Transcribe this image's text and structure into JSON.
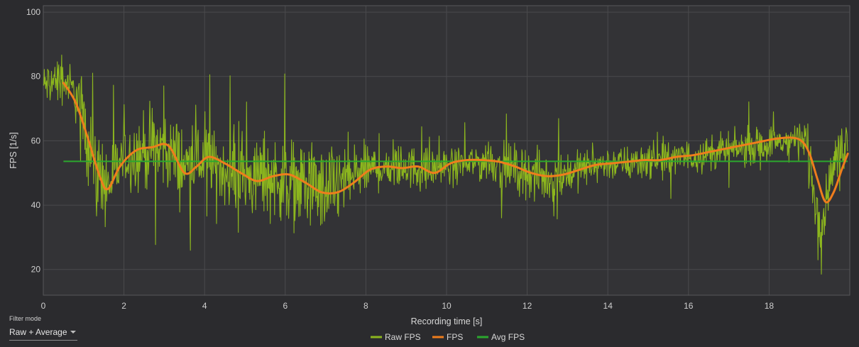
{
  "chart_data": {
    "type": "line",
    "xlabel": "Recording time [s]",
    "ylabel": "FPS [1/s]",
    "xlim": [
      0,
      20
    ],
    "ylim": [
      12,
      102
    ],
    "xticks": [
      0,
      2,
      4,
      6,
      8,
      10,
      12,
      14,
      16,
      18
    ],
    "yticks": [
      20,
      40,
      60,
      80,
      100
    ],
    "grid": true,
    "legend_position": "bottom-center",
    "series": [
      {
        "name": "Raw FPS",
        "color": "#8cb61e",
        "style": "noisy-line",
        "envelope_x": [
          0,
          0.3,
          0.6,
          0.9,
          1.1,
          1.3,
          1.6,
          2.0,
          2.5,
          3.0,
          3.5,
          4.0,
          4.5,
          5.0,
          5.5,
          6.0,
          6.5,
          7.0,
          7.5,
          8.0,
          8.5,
          9.0,
          9.5,
          10.0,
          10.5,
          11.0,
          11.5,
          12.0,
          12.5,
          13.0,
          13.5,
          14.0,
          14.5,
          15.0,
          15.5,
          16.0,
          16.5,
          17.0,
          17.5,
          18.0,
          18.5,
          18.9,
          19.1,
          19.3,
          19.5,
          19.7,
          19.95
        ],
        "envelope_center": [
          77,
          79,
          78,
          72,
          62,
          50,
          46,
          55,
          57,
          58,
          52,
          54,
          51,
          48,
          49,
          48,
          46,
          44,
          48,
          51,
          52,
          52,
          51,
          52,
          53,
          54,
          52,
          50,
          48,
          50,
          52,
          53,
          53,
          54,
          54,
          55,
          56,
          57,
          58,
          59,
          60,
          61,
          45,
          33,
          48,
          56,
          60
        ],
        "envelope_spread": [
          5,
          5,
          5,
          7,
          10,
          10,
          9,
          8,
          9,
          10,
          9,
          8,
          8,
          9,
          9,
          10,
          10,
          10,
          9,
          6,
          5,
          5,
          5,
          4,
          4,
          5,
          5,
          6,
          6,
          5,
          4,
          4,
          4,
          4,
          4,
          4,
          4,
          4,
          4,
          4,
          4,
          5,
          8,
          6,
          5,
          5,
          6
        ]
      },
      {
        "name": "FPS",
        "color": "#ef7d1c",
        "x": [
          0.5,
          0.8,
          1.1,
          1.4,
          1.6,
          1.9,
          2.3,
          2.7,
          3.1,
          3.5,
          3.8,
          4.1,
          4.5,
          4.9,
          5.3,
          5.7,
          6.1,
          6.5,
          6.9,
          7.3,
          7.7,
          8.1,
          8.5,
          8.9,
          9.3,
          9.7,
          10.1,
          10.5,
          10.9,
          11.3,
          11.7,
          12.1,
          12.5,
          12.9,
          13.3,
          13.7,
          14.1,
          14.5,
          14.9,
          15.3,
          15.7,
          16.1,
          16.5,
          16.9,
          17.3,
          17.7,
          18.1,
          18.5,
          18.8,
          19.0,
          19.2,
          19.4,
          19.6,
          19.8,
          19.95
        ],
        "y": [
          78,
          72,
          61,
          49,
          45,
          52,
          57,
          58,
          58.5,
          50,
          52,
          55,
          53,
          50,
          47.5,
          49,
          49.5,
          47,
          44,
          44,
          47,
          51,
          52,
          51.5,
          52,
          50,
          53,
          54,
          54,
          53.5,
          52,
          50,
          49,
          49.5,
          51,
          52.5,
          53,
          53.5,
          54,
          54,
          55,
          55.5,
          56.5,
          57.5,
          58.5,
          59.5,
          60.5,
          61,
          60,
          56,
          48,
          41,
          44,
          51,
          56
        ]
      },
      {
        "name": "Avg FPS",
        "color": "#2ba82e",
        "x": [
          0.5,
          19.95
        ],
        "y": [
          53.6,
          53.6
        ]
      }
    ]
  },
  "filter": {
    "caption": "Filter mode",
    "selected": "Raw + Average"
  }
}
